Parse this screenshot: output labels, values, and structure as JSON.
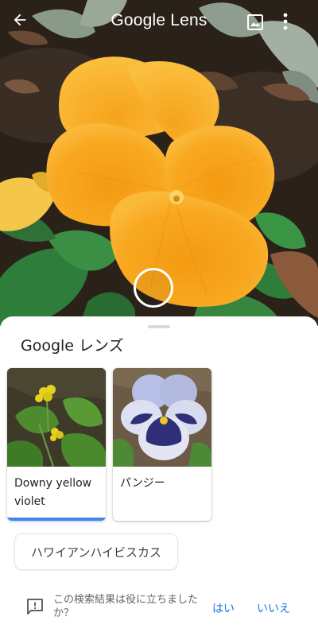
{
  "header": {
    "title": "Google Lens",
    "back_icon": "arrow-back-icon",
    "image_icon": "image-gallery-icon",
    "more_icon": "more-vert-icon"
  },
  "camera": {
    "shutter_icon": "shutter-ring-icon"
  },
  "results": {
    "title": "Google レンズ",
    "cards": [
      {
        "label": "Downy yellow violet",
        "selected": true
      },
      {
        "label": "パンジー",
        "selected": false
      }
    ],
    "chip": "ハワイアンハイビスカス"
  },
  "feedback": {
    "icon": "feedback-icon",
    "question": "この検索結果は役に立ちましたか？",
    "yes": "はい",
    "no": "いいえ"
  },
  "colors": {
    "accent": "#1a73e8",
    "selected_underline": "#4285f4",
    "flower_orange": "#f7a01c"
  }
}
